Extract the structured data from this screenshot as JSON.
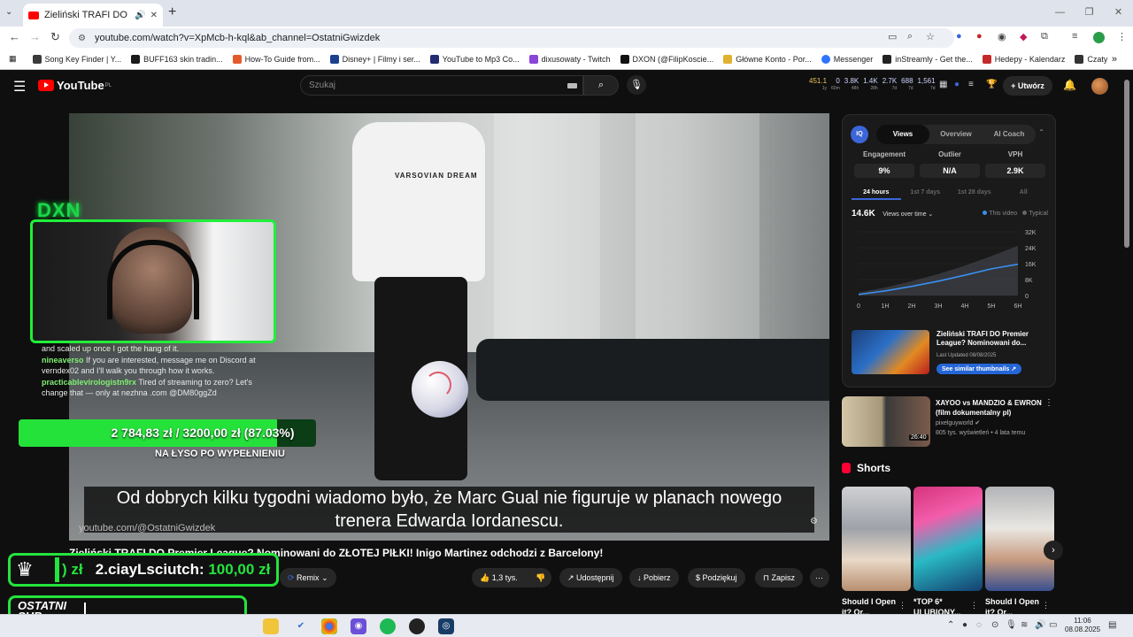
{
  "browser": {
    "tab_title": "Zieliński TRAFI DO Premier League? Nominowani do ZŁOTEJ PIŁKI!",
    "url": "youtube.com/watch?v=XpMcb-h-kql&ab_channel=OstatniGwizdek",
    "bookmarks": [
      "Song Key Finder | Y...",
      "BUFF163 skin tradin...",
      "How-To Guide from...",
      "Disney+ | Filmy i ser...",
      "YouTube to Mp3 Co...",
      "dixusowaty - Twitch",
      "DXON (@FilipKoscie...",
      "Główne Konto - Por...",
      "Messenger",
      "inStreamly - Get the...",
      "Hedepy - Kalendarz",
      "Czaty"
    ],
    "bookmark_colors": [
      "#3a3a3a",
      "#1a1a1a",
      "#e45b2b",
      "#1c3f8e",
      "#222c6e",
      "#8b45d9",
      "#111111",
      "#e0b030",
      "#2e74ff",
      "#222222",
      "#c42a2a",
      "#333333"
    ]
  },
  "youtube": {
    "logo": "YouTube",
    "region": "PL",
    "search_placeholder": "Szukaj",
    "create_label": "Utwórz",
    "header_stats": [
      {
        "value": "451.1",
        "sub": "1y",
        "color": "#f0c35a"
      },
      {
        "value": "0",
        "sub": "60m",
        "color": "#cfd6ff"
      },
      {
        "value": "3.8K",
        "sub": "48h",
        "color": "#cfd6ff"
      },
      {
        "value": "1.4K",
        "sub": "28h",
        "color": "#cfd6ff"
      },
      {
        "value": "2.7K",
        "sub": "7d",
        "color": "#cfd6ff"
      },
      {
        "value": "688",
        "sub": "7d",
        "color": "#cfd6ff"
      },
      {
        "value": "1,561",
        "sub": "7d",
        "color": "#cfd6ff"
      }
    ]
  },
  "stream": {
    "brand": "DXN",
    "chat": [
      {
        "user": "",
        "text": "and scaled up once I got the hang of it."
      },
      {
        "user": "nineaverso",
        "text": "If you are interested, message me on Discord at verndex02 and I'll walk you through how it works."
      },
      {
        "user": "practicablevirologistn9rx",
        "text": "Tired of streaming to zero? Let's change that — only at nezhna .com @DM80ggZd"
      }
    ],
    "goal_text": "2 784,83 zł  /  3200,00 zł (87.03%)",
    "goal_progress": 87.03,
    "goal_caption": "NA ŁYSO PO WYPEŁNIENIU",
    "sub_prefix": ") zł",
    "sub_user": "2.ciayLsciutch:",
    "sub_amount": "100,00 zł",
    "last_sub_label": "OSTATNI SUB"
  },
  "video": {
    "shirt_text": "VARSOVIAN DREAM",
    "subtitle_line1": "Od dobrych kilku tygodni wiadomo było, że Marc Gual nie figuruje w planach nowego",
    "subtitle_line2": "trenera Edwarda Iordanescu.",
    "title": "Zieliński TRAFI DO Premier League? Nominowani do ZŁOTEJ PIŁKI! Inigo Martinez odchodzi z Barcelony!",
    "channel_overlay": "youtube.com/@OstatniGwizdek",
    "remix": "Remix",
    "likes": "1,3 tys.",
    "share": "Udostępnij",
    "download": "Pobierz",
    "thanks": "Podziękuj",
    "save": "Zapisz"
  },
  "panel": {
    "logo": "IQ",
    "tabs": [
      "Views",
      "Overview",
      "AI Coach"
    ],
    "active_tab": "Views",
    "metrics": [
      {
        "label": "Engagement",
        "value": "9%"
      },
      {
        "label": "Outlier",
        "value": "N/A"
      },
      {
        "label": "VPH",
        "value": "2.9K"
      }
    ],
    "ranges": [
      "24 hours",
      "1st 7 days",
      "1st 28 days",
      "All"
    ],
    "active_range": "24 hours",
    "views_total": "14.6K",
    "views_mode": "Views over time",
    "legend_this": "This video",
    "legend_typical": "Typical",
    "video_title": "Zieliński TRAFI DO Premier League? Nominowani do...",
    "last_updated": "Last Updated 08/08/2025",
    "similar_btn": "See similar thumbnails ↗"
  },
  "chart_data": {
    "type": "area",
    "x": [
      "0",
      "1H",
      "2H",
      "3H",
      "4H",
      "5H",
      "6H"
    ],
    "yticks": [
      "0",
      "8K",
      "16K",
      "24K",
      "32K"
    ],
    "ylim": [
      0,
      32000
    ],
    "series": [
      {
        "name": "This video",
        "values": [
          500,
          2300,
          4600,
          7200,
          10200,
          13400,
          15700
        ],
        "color": "#3b8ff0"
      },
      {
        "name": "Typical",
        "values": [
          1500,
          4000,
          7200,
          10800,
          15000,
          19800,
          25000
        ],
        "color": "#4a4f57"
      }
    ]
  },
  "recommended": {
    "title": "XAYOO vs MANDZIO & EWRON (film dokumentalny pl)",
    "channel": "pixelguyworld ✔",
    "meta": "805 tys. wyświetleń • 4 lata temu",
    "duration": "26:40"
  },
  "shorts": {
    "heading": "Shorts",
    "items": [
      {
        "title": "Should I Open it? Or..."
      },
      {
        "title": "*TOP 6* ULUBIONY..."
      },
      {
        "title": "Should I Open it? Or..."
      }
    ]
  },
  "taskbar": {
    "time": "11:06",
    "date": "08.08.2025"
  }
}
